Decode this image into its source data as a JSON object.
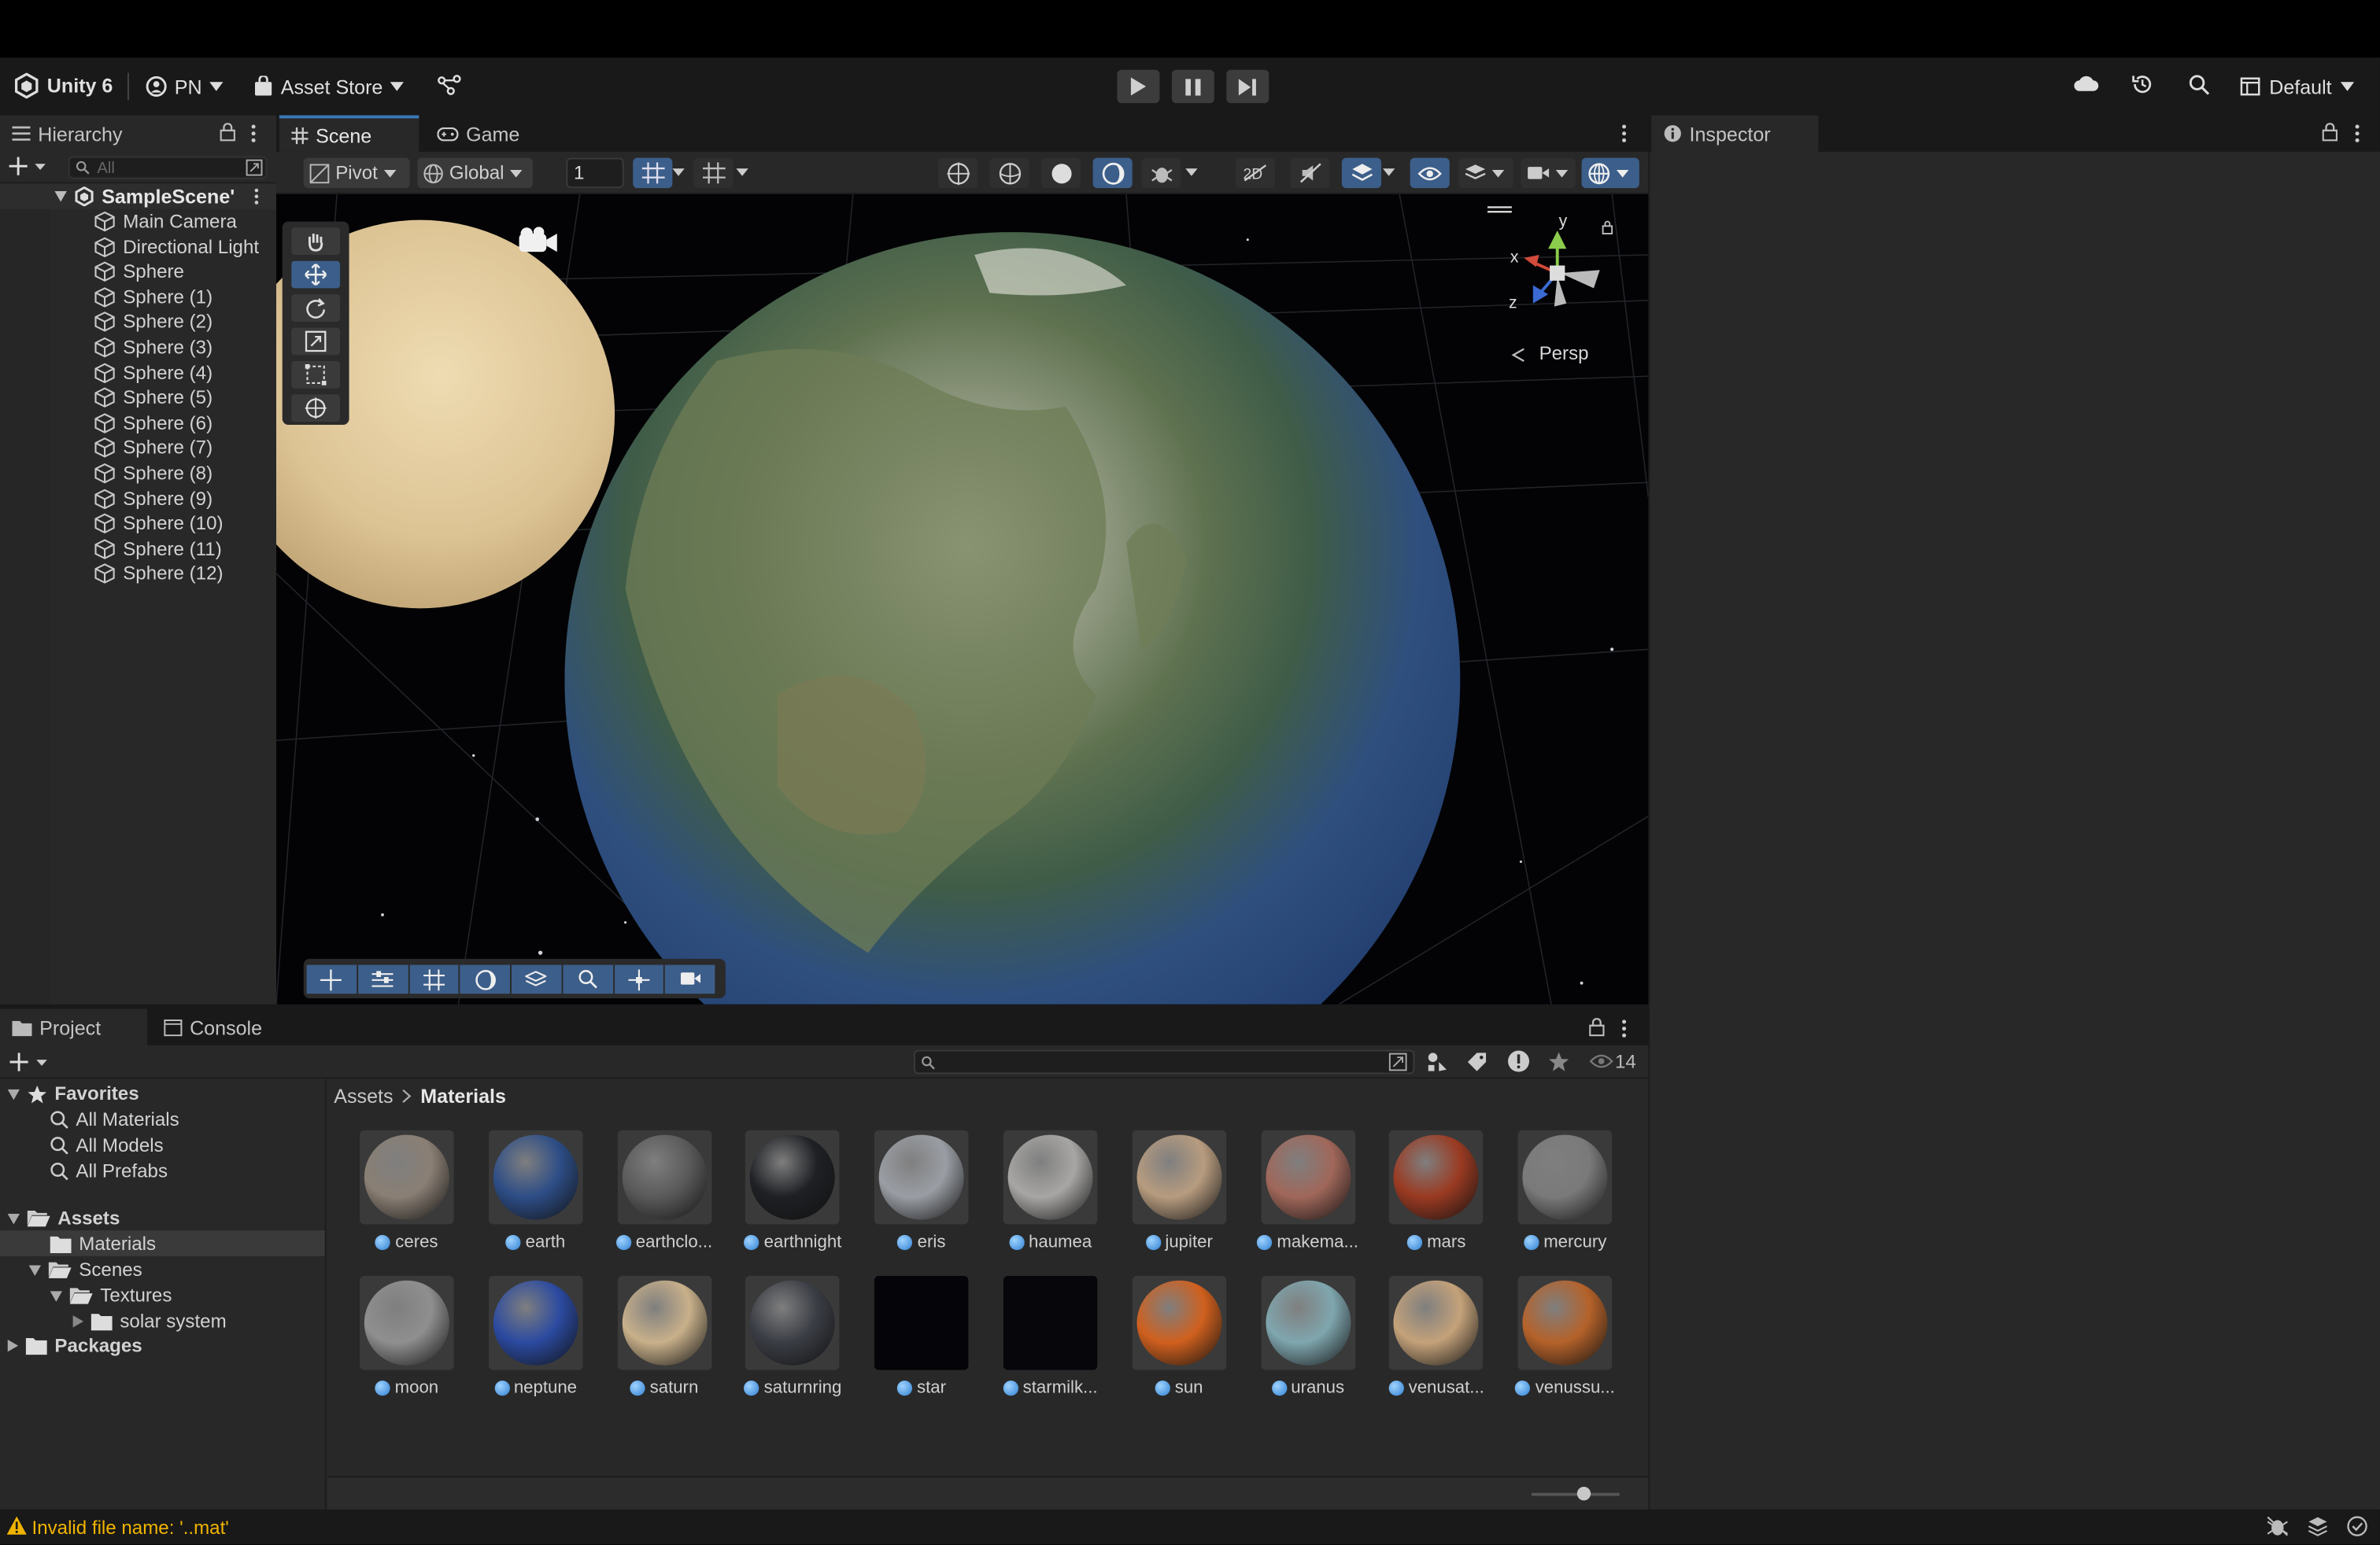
{
  "toolbar": {
    "app_name": "Unity 6",
    "account": "PN",
    "asset_store": "Asset Store",
    "layout": "Default"
  },
  "hierarchy": {
    "tab": "Hierarchy",
    "search_placeholder": "All",
    "scene_name": "SampleScene'",
    "items": [
      "Main Camera",
      "Directional Light",
      "Sphere",
      "Sphere (1)",
      "Sphere (2)",
      "Sphere (3)",
      "Sphere (4)",
      "Sphere (5)",
      "Sphere (6)",
      "Sphere (7)",
      "Sphere (8)",
      "Sphere (9)",
      "Sphere (10)",
      "Sphere (11)",
      "Sphere (12)"
    ]
  },
  "scene": {
    "tabs": [
      "Scene",
      "Game"
    ],
    "pivot": "Pivot",
    "global": "Global",
    "grid_value": "1",
    "persp_label": "Persp",
    "axis_y": "y",
    "axis_x": "x",
    "axis_z": "z"
  },
  "inspector": {
    "tab": "Inspector"
  },
  "project": {
    "tabs": [
      "Project",
      "Console"
    ],
    "count": "14",
    "breadcrumb_root": "Assets",
    "breadcrumb_current": "Materials",
    "favorites": {
      "label": "Favorites",
      "items": [
        "All Materials",
        "All Models",
        "All Prefabs"
      ]
    },
    "assets_tree": {
      "label": "Assets",
      "materials": "Materials",
      "scenes": "Scenes",
      "textures": "Textures",
      "solar_system": "solar system"
    },
    "packages": "Packages",
    "assets": [
      {
        "name": "ceres",
        "color": "#8a7f74"
      },
      {
        "name": "earth",
        "color": "#2d4d86"
      },
      {
        "name": "earthclo...",
        "color": "#5a5a5a"
      },
      {
        "name": "earthnight",
        "color": "#1e2024"
      },
      {
        "name": "eris",
        "color": "#9a9ea4"
      },
      {
        "name": "haumea",
        "color": "#a7a6a4"
      },
      {
        "name": "jupiter",
        "color": "#b79c7f"
      },
      {
        "name": "makema...",
        "color": "#a0675a"
      },
      {
        "name": "mars",
        "color": "#9a3a22"
      },
      {
        "name": "mercury",
        "color": "#7a7a7a"
      },
      {
        "name": "moon",
        "color": "#8f8f8f"
      },
      {
        "name": "neptune",
        "color": "#2b4aa0"
      },
      {
        "name": "saturn",
        "color": "#c8b08a"
      },
      {
        "name": "saturnring",
        "color": "#3a3d44"
      },
      {
        "name": "star",
        "color": "#050509"
      },
      {
        "name": "starmilk...",
        "color": "#06060b"
      },
      {
        "name": "sun",
        "color": "#d0601e"
      },
      {
        "name": "uranus",
        "color": "#7fa6ae"
      },
      {
        "name": "venusat...",
        "color": "#c4a27a"
      },
      {
        "name": "venussu...",
        "color": "#b5622a"
      }
    ]
  },
  "status": {
    "message": "Invalid file name: '..mat'"
  }
}
